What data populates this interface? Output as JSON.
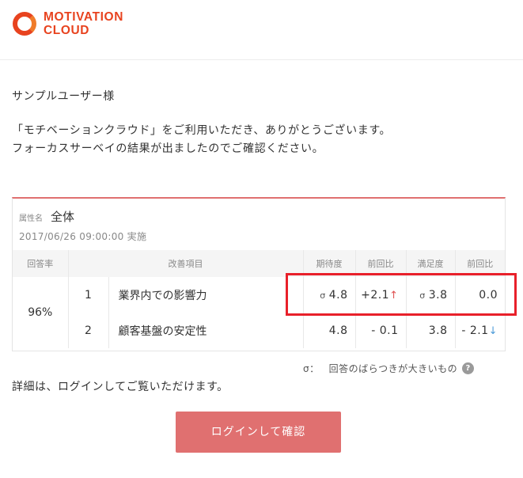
{
  "brand": {
    "line1": "MOTIVATION",
    "line2": "CLOUD",
    "color": "#e8431f"
  },
  "greeting": "サンプルユーザー様",
  "intro": {
    "line1": "「モチベーションクラウド」をご利用いただき、ありがとうございます。",
    "line2": "フォーカスサーベイの結果が出ましたのでご確認ください。"
  },
  "card": {
    "attr_label": "属性名",
    "attr_value": "全体",
    "date": "2017/06/26 09:00:00 実施",
    "headers": {
      "rate": "回答率",
      "item": "改善項目",
      "expect": "期待度",
      "expect_diff": "前回比",
      "satisfy": "満足度",
      "satisfy_diff": "前回比"
    },
    "rate": "96%",
    "rows": [
      {
        "no": "1",
        "item": "業界内での影響力",
        "sigma_expect": "σ",
        "expect": "4.8",
        "expect_diff": "+2.1",
        "expect_arrow": "↑",
        "sigma_satisfy": "σ",
        "satisfy": "3.8",
        "satisfy_diff": "0.0",
        "satisfy_arrow": ""
      },
      {
        "no": "2",
        "item": "顧客基盤の安定性",
        "sigma_expect": "",
        "expect": "4.8",
        "expect_diff": "- 0.1",
        "expect_arrow": "",
        "sigma_satisfy": "",
        "satisfy": "3.8",
        "satisfy_diff": "- 2.1",
        "satisfy_arrow": "↓"
      }
    ]
  },
  "note": {
    "symbol": "σ：",
    "text": "回答のばらつきが大きいもの",
    "help_icon": "?"
  },
  "detail": "詳細は、ログインしてご覧いただけます。",
  "login_button": "ログインして確認",
  "colors": {
    "accent": "#e07070",
    "up": "#e05050",
    "down": "#4a9ad8",
    "highlight": "#e8202a"
  }
}
